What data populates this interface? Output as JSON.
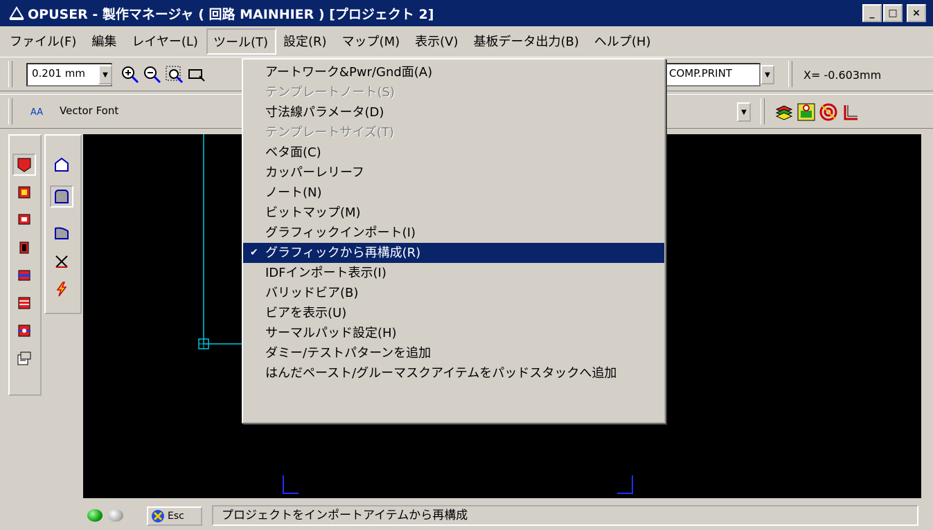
{
  "window": {
    "title": "OPUSER - 製作マネージャ ( 回路 MAINHIER ) [プロジェクト 2]",
    "min": "_",
    "max": "□",
    "close": "×"
  },
  "menubar": [
    {
      "label": "ファイル(F)"
    },
    {
      "label": "編集"
    },
    {
      "label": "レイヤー(L)"
    },
    {
      "label": "ツール(T)"
    },
    {
      "label": "設定(R)"
    },
    {
      "label": "マップ(M)"
    },
    {
      "label": "表示(V)"
    },
    {
      "label": "基板データ出力(B)"
    },
    {
      "label": "ヘルプ(H)"
    }
  ],
  "toolbar1": {
    "grid_value": "0.201 mm",
    "layer_value": "COMP.PRINT",
    "coordinate": "X= -0.603mm"
  },
  "toolbar2": {
    "font_prefix": "AA",
    "font_value": "Vector Font"
  },
  "tools_menu": {
    "items": [
      {
        "label": "アートワーク&Pwr/Gnd面(A)",
        "disabled": false,
        "checked": false
      },
      {
        "label": "テンプレートノート(S)",
        "disabled": true,
        "checked": false
      },
      {
        "label": "寸法線パラメータ(D)",
        "disabled": false,
        "checked": false
      },
      {
        "label": "テンプレートサイズ(T)",
        "disabled": true,
        "checked": false
      },
      {
        "label": "ベタ面(C)",
        "disabled": false,
        "checked": false
      },
      {
        "label": "カッパーレリーフ",
        "disabled": false,
        "checked": false
      },
      {
        "label": "ノート(N)",
        "disabled": false,
        "checked": false
      },
      {
        "label": "ビットマップ(M)",
        "disabled": false,
        "checked": false
      },
      {
        "label": "グラフィックインポート(I)",
        "disabled": false,
        "checked": false
      },
      {
        "label": "グラフィックから再構成(R)",
        "disabled": false,
        "checked": true,
        "selected": true
      },
      {
        "label": "IDFインポート表示(I)",
        "disabled": false,
        "checked": false
      },
      {
        "label": "バリッドビア(B)",
        "disabled": false,
        "checked": false
      },
      {
        "label": "ビアを表示(U)",
        "disabled": false,
        "checked": false
      },
      {
        "label": "サーマルパッド設定(H)",
        "disabled": false,
        "checked": false
      },
      {
        "label": "ダミー/テストパターンを追加",
        "disabled": false,
        "checked": false
      },
      {
        "label": "はんだペースト/グルーマスクアイテムをパッドスタックへ追加",
        "disabled": false,
        "checked": false
      }
    ],
    "check_mark": "✔"
  },
  "statusbar": {
    "esc_label": "Esc",
    "message": "プロジェクトをインポートアイテムから再構成"
  },
  "colors": {
    "title_bg": "#0a246a",
    "selection_bg": "#0a246a",
    "canvas_bg": "#000000",
    "trace": "#00c8e0",
    "outline": "#2030ff"
  }
}
